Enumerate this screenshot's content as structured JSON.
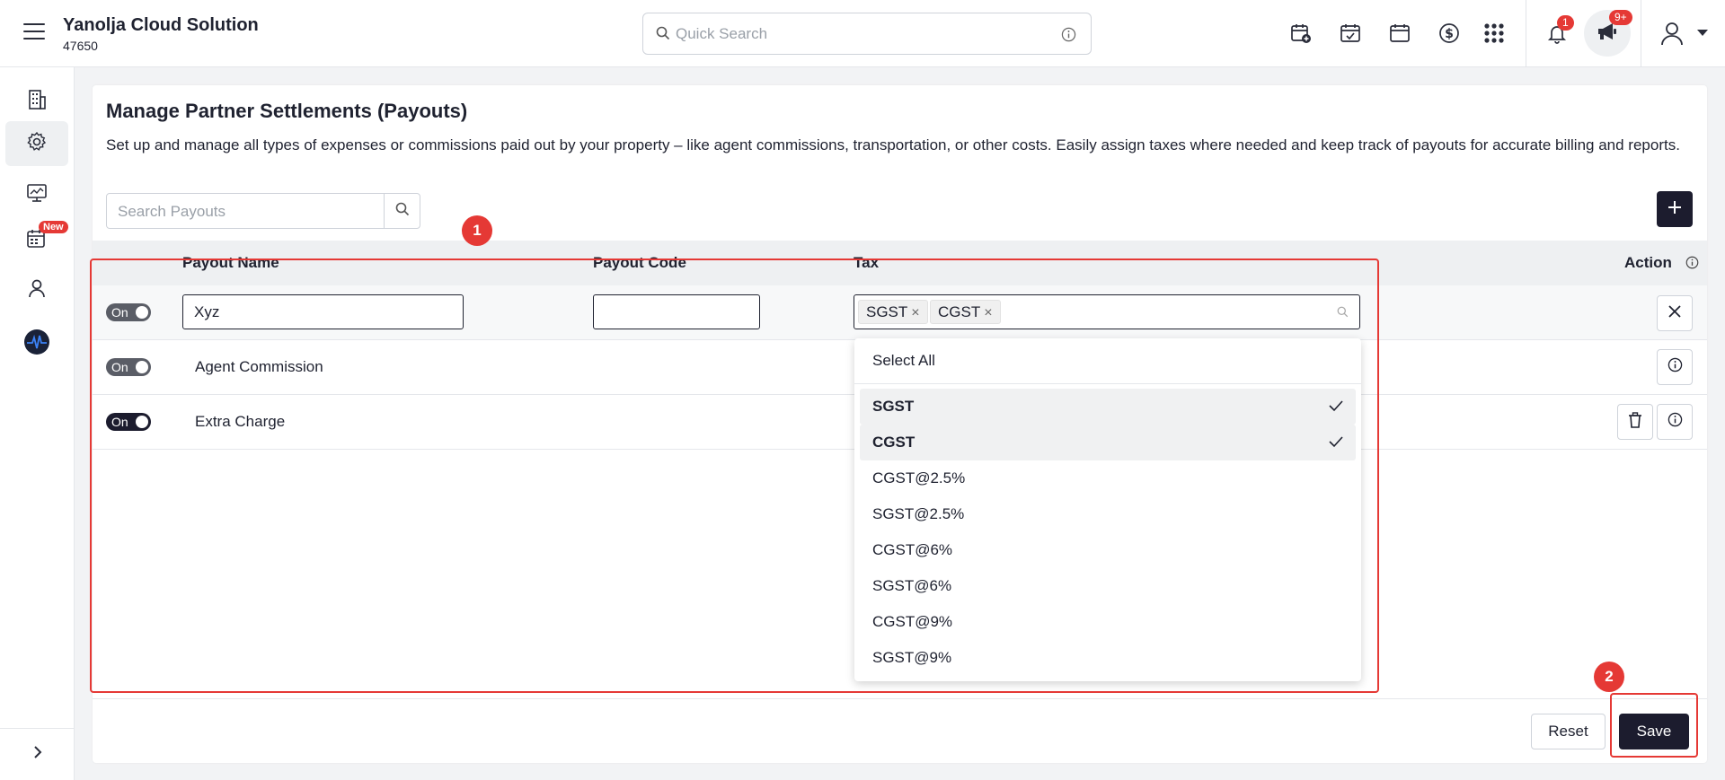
{
  "header": {
    "brand_title": "Yanolja Cloud Solution",
    "brand_id": "47650",
    "search_placeholder": "Quick Search",
    "notification_count": "1",
    "announcement_count": "9+",
    "icons": [
      "calendar-plus-icon",
      "calendar-check-icon",
      "calendar-icon",
      "dollar-icon",
      "apps-grid-icon",
      "bell-icon",
      "megaphone-icon",
      "user-icon",
      "chevron-down-icon"
    ]
  },
  "sidebar": {
    "items": [
      "building-icon",
      "gear-icon",
      "monitor-icon",
      "calendar-list-icon",
      "user-icon",
      "pulse-icon"
    ],
    "new_badge": "New",
    "expand_icon": "chevron-right-icon"
  },
  "page": {
    "title": "Manage Partner Settlements (Payouts)",
    "description": "Set up and manage all types of expenses or commissions paid out by your property – like agent commissions, transportation, or other costs. Easily assign taxes where needed and keep track of payouts for accurate billing and reports.",
    "search_placeholder": "Search Payouts"
  },
  "table": {
    "columns": {
      "name": "Payout Name",
      "code": "Payout Code",
      "tax": "Tax",
      "action": "Action"
    },
    "rows": [
      {
        "status": "On",
        "name": "Xyz",
        "code": "",
        "taxes": [
          "SGST",
          "CGST"
        ],
        "editing": true
      },
      {
        "status": "On",
        "name": "Agent Commission"
      },
      {
        "status": "On",
        "name": "Extra Charge"
      }
    ]
  },
  "dropdown": {
    "select_all": "Select All",
    "options": [
      {
        "label": "SGST",
        "selected": true
      },
      {
        "label": "CGST",
        "selected": true
      },
      {
        "label": "CGST@2.5%",
        "selected": false
      },
      {
        "label": "SGST@2.5%",
        "selected": false
      },
      {
        "label": "CGST@6%",
        "selected": false
      },
      {
        "label": "SGST@6%",
        "selected": false
      },
      {
        "label": "CGST@9%",
        "selected": false
      },
      {
        "label": "SGST@9%",
        "selected": false
      }
    ]
  },
  "footer": {
    "reset_label": "Reset",
    "save_label": "Save"
  },
  "annotations": {
    "one": "1",
    "two": "2"
  },
  "colors": {
    "accent": "#1c1c2e",
    "annotation": "#e53935"
  }
}
